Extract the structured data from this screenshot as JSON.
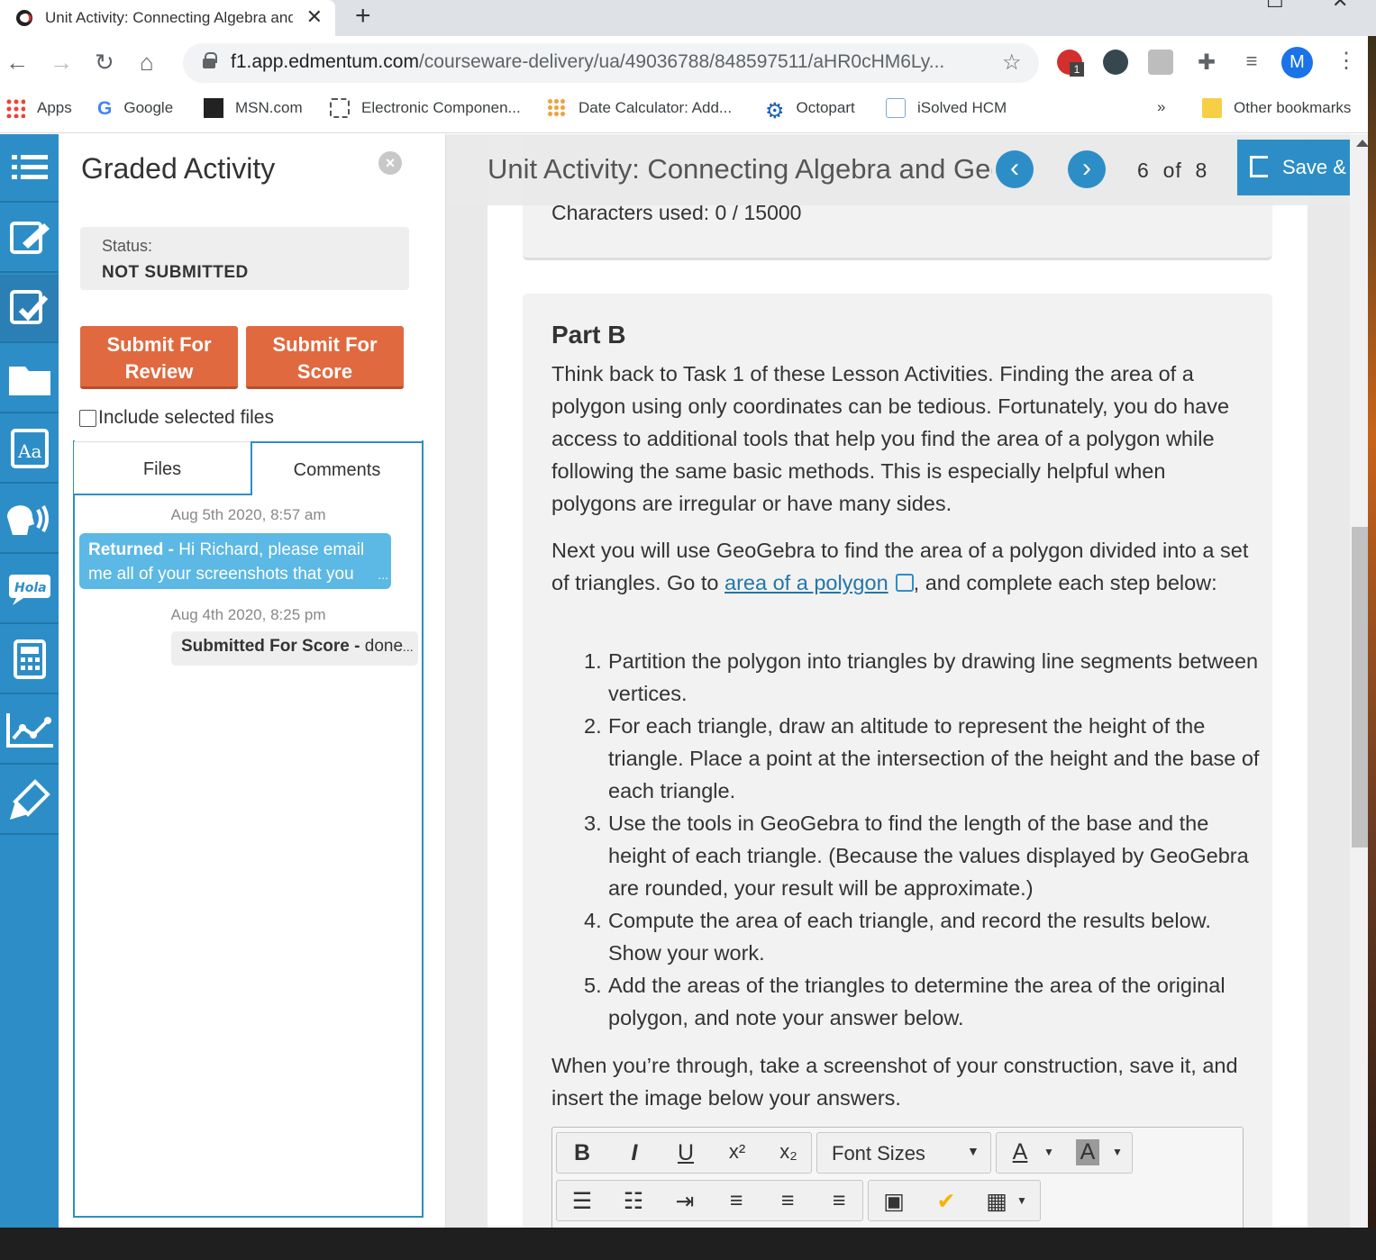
{
  "browser": {
    "tab_title": "Unit Activity: Connecting Algebra and Geometry",
    "tab_close": "✕",
    "new_tab": "+",
    "url_domain": "f1.app.edmentum.com",
    "url_path": "/courseware-delivery/ua/49036788/848597511/aHR0cHM6Ly...",
    "extension_badge": "1",
    "avatar_letter": "M",
    "bookmarks": [
      {
        "label": "Apps",
        "icon": "apps-grid-icon"
      },
      {
        "label": "Google",
        "icon": "google-g-icon"
      },
      {
        "label": "MSN.com",
        "icon": "msn-icon"
      },
      {
        "label": "Electronic Componen...",
        "icon": "chip-icon"
      },
      {
        "label": "Date Calculator: Add...",
        "icon": "dots-icon"
      },
      {
        "label": "Octopart",
        "icon": "gear-icon"
      },
      {
        "label": "iSolved HCM",
        "icon": "info-icon"
      }
    ],
    "bookmarks_overflow": "»",
    "other_bookmarks": "Other bookmarks"
  },
  "panel": {
    "title": "Graded Activity",
    "status_label": "Status:",
    "status_value": "NOT SUBMITTED",
    "submit_review_line1": "Submit For",
    "submit_review_line2": "Review",
    "submit_score_line1": "Submit For",
    "submit_score_line2": "Score",
    "include_files": "Include selected files",
    "tab_files": "Files",
    "tab_comments": "Comments",
    "comments": [
      {
        "date": "Aug 5th 2020, 8:57 am",
        "status": "Returned -",
        "text": " Hi Richard, please email me all of your screenshots that you"
      },
      {
        "date": "Aug 4th 2020, 8:25 pm",
        "status": "Submitted For Score -",
        "text": " done"
      }
    ],
    "ellipsis": "..."
  },
  "header": {
    "title": "Unit Activity: Connecting Algebra and Geometry",
    "page_current": "6",
    "page_of": "of",
    "page_total": "8",
    "save_label": "Save &"
  },
  "content": {
    "chars_used": "Characters used: 0 / 15000",
    "part_title": "Part B",
    "para1": "Think back to Task 1 of these Lesson Activities. Finding the area of a polygon using only coordinates can be tedious. Fortunately, you do have access to additional tools that help you find the area of a polygon while following the same basic methods. This is especially helpful when polygons are irregular or have many sides.",
    "para2_before": "Next you will use GeoGebra to find the area of a polygon divided into a set of triangles. Go to ",
    "para2_link": "area of a polygon",
    "para2_after": ", and complete each step below:",
    "steps": [
      {
        "num": "1.",
        "text": "Partition the polygon into triangles by drawing line segments between vertices."
      },
      {
        "num": "2.",
        "text": "For each triangle, draw an altitude to represent the height of the triangle. Place a point at the intersection of the height and the base of each triangle."
      },
      {
        "num": "3.",
        "text": "Use the tools in GeoGebra to find the length of the base and the height of each triangle. (Because the values displayed by GeoGebra are rounded, your result will be approximate.)"
      },
      {
        "num": "4.",
        "text": "Compute the area of each triangle, and record the results below. Show your work."
      },
      {
        "num": "5.",
        "text": "Add the areas of the triangles to determine the area of the original polygon, and note your answer below."
      }
    ],
    "para3": "When you’re through, take a screenshot of your construction, save it, and insert the image below your answers."
  },
  "editor": {
    "bold": "B",
    "italic": "I",
    "underline": "U",
    "superscript": "x²",
    "subscript": "x₂",
    "font_sizes": "Font Sizes",
    "font_color": "A",
    "bg_color": "A"
  },
  "colors": {
    "accent": "#2d8ec7",
    "submit": "#e0693f",
    "returned_bubble": "#5cb8e4"
  }
}
